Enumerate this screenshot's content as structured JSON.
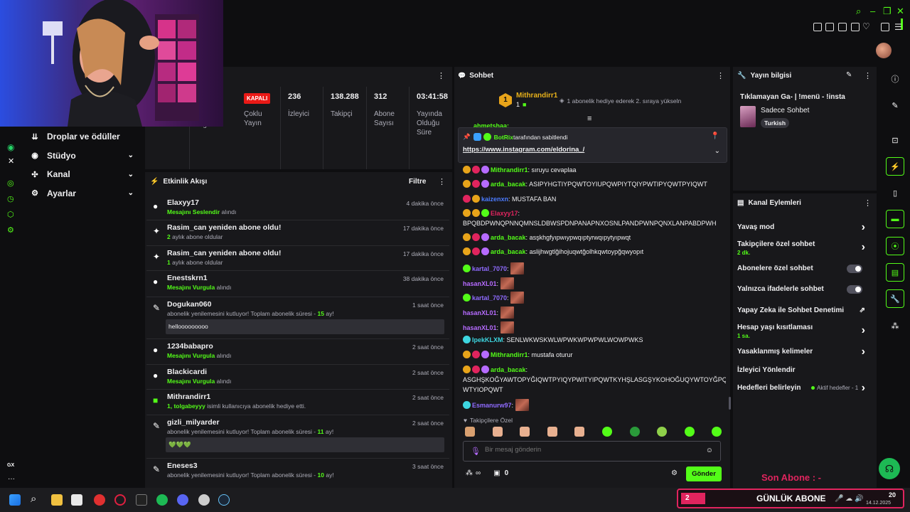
{
  "stats": [
    {
      "value": "",
      "label": "...ik Programı"
    },
    {
      "value": "KAPALI",
      "label": "Çoklu Yayın"
    },
    {
      "value": "236",
      "label": "İzleyici"
    },
    {
      "value": "138.288",
      "label": "Takipçi"
    },
    {
      "value": "312",
      "label": "Abone Sayısı"
    },
    {
      "value": "03:41:58",
      "label": "Yayında Olduğu Süre"
    }
  ],
  "nav": {
    "items": [
      {
        "label": "Droplar ve ödüller",
        "has_chevron": false
      },
      {
        "label": "Stüdyo",
        "has_chevron": true
      },
      {
        "label": "Kanal",
        "has_chevron": true
      },
      {
        "label": "Ayarlar",
        "has_chevron": true
      }
    ],
    "gx_label": "GX"
  },
  "feed": {
    "title": "Etkinlik Akışı",
    "filter_label": "Filtre",
    "rows": [
      {
        "name": "Elaxyy17",
        "hl": "Mesajını Seslendir",
        "rest": " alındı",
        "time": "4 dakika önce",
        "icon": "●"
      },
      {
        "name": "Rasim_can yeniden abone oldu!",
        "hl": "2",
        "rest": " aylık abone oldular",
        "time": "17 dakika önce",
        "icon": "✦"
      },
      {
        "name": "Rasim_can yeniden abone oldu!",
        "hl": "1",
        "rest": " aylık abone oldular",
        "time": "17 dakika önce",
        "icon": "✦"
      },
      {
        "name": "Enestskrn1",
        "hl": "Mesajını Vurgula",
        "rest": " alındı",
        "time": "38 dakika önce",
        "icon": "●"
      },
      {
        "name": "Dogukan060",
        "hl": "",
        "rest": "abonelik yenilemesini kutluyor! Toplam abonelik süresi - ",
        "months": "15",
        "time": "1 saat önce",
        "msg": "hellooooooooo",
        "icon": "✎"
      },
      {
        "name": "1234babapro",
        "hl": "Mesajını Vurgula",
        "rest": " alındı",
        "time": "2 saat önce",
        "icon": "●"
      },
      {
        "name": "Blackicardi",
        "hl": "Mesajını Vurgula",
        "rest": " alındı",
        "time": "2 saat önce",
        "icon": "●"
      },
      {
        "name": "Mithrandirr1",
        "hl": "1, tolgabeyyy",
        "rest": " isimli kullanıcıya abonelik hediye etti.",
        "time": "2 saat önce",
        "icon": "■"
      },
      {
        "name": "gizli_milyarder",
        "hl": "",
        "rest": "abonelik yenilemesini kutluyor! Toplam abonelik süresi - ",
        "months": "11",
        "time": "2 saat önce",
        "msg": "💚💚💚",
        "icon": "✎"
      },
      {
        "name": "Eneses3",
        "hl": "",
        "rest": "abonelik yenilemesini kutluyor! Toplam abonelik süresi - ",
        "months": "10",
        "time": "3 saat önce",
        "icon": "✎"
      }
    ],
    "suffix_ay": " ay!"
  },
  "chat": {
    "title": "Sohbet",
    "top_gifter": {
      "name": "Mithrandirr1",
      "rank": "1",
      "count": "1",
      "msg": "1 abonelik hediye ederek 2. sıraya yükseln"
    },
    "partial_user": "ahmetshaa:",
    "pinned": {
      "by": "BotRix",
      "label": " tarafından sabitlendi",
      "link": "https://www.instagram.com/eldorina_/"
    },
    "lines": [
      {
        "user": "Mithrandirr1",
        "color": "#53fc18",
        "text": "sıruyu cevaplaa"
      },
      {
        "user": "arda_bacak",
        "color": "#53fc18",
        "text": "ASIPYHGTIYPQWTOYIUPQWPIYTQIYPWTIPYQWTPYIQWT"
      },
      {
        "user": "kaizenxn",
        "color": "#4b7bff",
        "text": "MUSTAFA BAN"
      },
      {
        "user": "Elaxyy17",
        "color": "#e0245e",
        "text": "",
        "text2": "BPQBDPWNQPNNQMNSLDBWSPDNPANAPNXOSNLPANDPWNPQNXLANPABDPWH"
      },
      {
        "user": "arda_bacak",
        "color": "#53fc18",
        "text": "asşkhgfyıpwıypwqıptyrwqıpytyıpwqt"
      },
      {
        "user": "arda_bacak",
        "color": "#53fc18",
        "text": "aslijhwgtlğihojuqwtğolhkqwtoypğqwyopıt"
      },
      {
        "user": "kartal_7070",
        "color": "#8f6bff",
        "text": ""
      },
      {
        "user": "hasanXL01",
        "color": "#b66bff",
        "text": ""
      },
      {
        "user": "kartal_7070",
        "color": "#8f6bff",
        "text": ""
      },
      {
        "user": "hasanXL01",
        "color": "#b66bff",
        "text": ""
      },
      {
        "user": "hasanXL01",
        "color": "#b66bff",
        "text": ""
      },
      {
        "user": "IpekKLXM",
        "color": "#3dd6e0",
        "text": "SENLWKWSKWLWPWKWPWPWLWOWPWKS"
      },
      {
        "user": "Mithrandirr1",
        "color": "#53fc18",
        "text": "mustafa oturur"
      },
      {
        "user": "arda_bacak",
        "color": "#53fc18",
        "text": "",
        "text2": "ASGHŞKOĞYAWTOPYĞIQWTPYIQYPWITYIPQWTKYHŞLASGŞYKOHOĞUQYWTOYĞPQ",
        "text3": "WTYIOPQWT"
      },
      {
        "user": "Esmanurw97",
        "color": "#8f6bff",
        "text": ""
      }
    ],
    "followers_only": "Takipçilere Özel",
    "input_placeholder": "Bir mesaj gönderin",
    "store_count": "0",
    "send_label": "Gönder"
  },
  "stream_info": {
    "title": "Yayın bilgisi",
    "stream_title": "Tıklamayan Ga- | !menü - !insta",
    "category": "Sadece Sohbet",
    "tag": "Turkish"
  },
  "channel_actions": {
    "title": "Kanal Eylemleri",
    "rows": [
      {
        "label": "Yavaş mod",
        "sub": "",
        "ctl": "chev"
      },
      {
        "label": "Takipçilere özel sohbet",
        "sub": "2 dk.",
        "ctl": "chev"
      },
      {
        "label": "Abonelere özel sohbet",
        "sub": "",
        "ctl": "toggle"
      },
      {
        "label": "Yalnızca ifadelerle sohbet",
        "sub": "",
        "ctl": "toggle"
      },
      {
        "label": "Yapay Zeka ile Sohbet Denetimi",
        "sub": "",
        "ctl": "ext"
      },
      {
        "label": "Hesap yaşı kısıtlaması",
        "sub": "1 sa.",
        "ctl": "chev"
      },
      {
        "label": "Yasaklanmış kelimeler",
        "sub": "",
        "ctl": "chev"
      },
      {
        "label": "İzleyici Yönlendir",
        "sub": "",
        "ctl": "none"
      },
      {
        "label": "Hedefleri belirleyin",
        "sub": "",
        "ctl": "chev",
        "extra": "Aktif hedefler - 1"
      }
    ]
  },
  "overlay": {
    "son_abone": "Son Abone : -",
    "sub_count": "2",
    "gunluk": "GÜNLÜK ABONE",
    "clock": "20",
    "date": "14.12.2025"
  },
  "colors": {
    "accent": "#53fc18",
    "panel": "#18181b",
    "bg": "#0e0e10",
    "kapali": "#e91916"
  }
}
